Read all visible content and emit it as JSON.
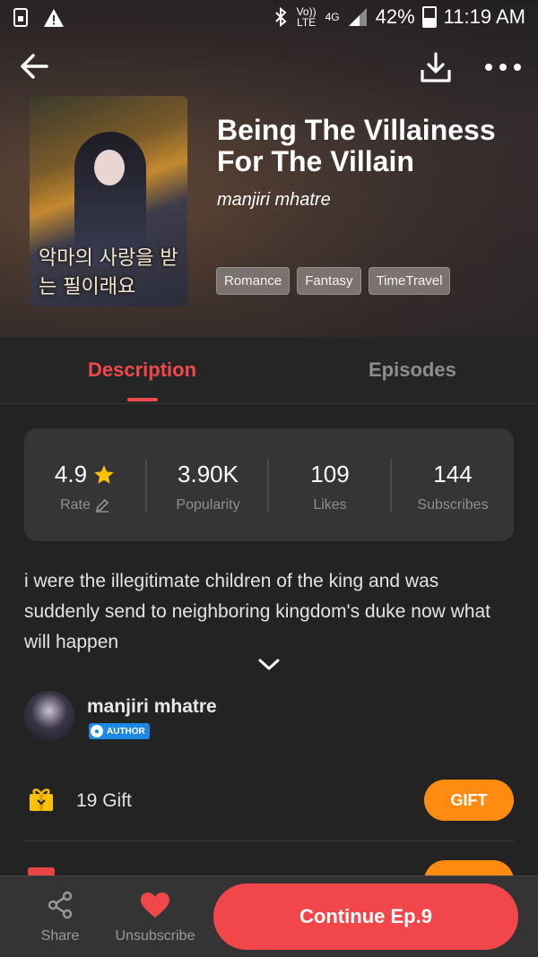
{
  "status": {
    "network_label": "Vo)) LTE",
    "net_type": "4G",
    "battery": "42%",
    "time": "11:19 AM",
    "battery_level": 0.42
  },
  "comic": {
    "title": "Being The Villainess For The Villain",
    "author": "manjiri mhatre",
    "tags": [
      "Romance",
      "Fantasy",
      "TimeTravel"
    ],
    "cover_text": "악마의 사랑을 받는 필이래요"
  },
  "tabs": [
    {
      "label": "Description",
      "active": true
    },
    {
      "label": "Episodes",
      "active": false
    }
  ],
  "stats": [
    {
      "value": "4.9",
      "label": "Rate"
    },
    {
      "value": "3.90K",
      "label": "Popularity"
    },
    {
      "value": "109",
      "label": "Likes"
    },
    {
      "value": "144",
      "label": "Subscribes"
    }
  ],
  "description": "i were the illegitimate children of the king and was suddenly send to neighboring kingdom's duke now what will happen",
  "author_section": {
    "name": "manjiri mhatre",
    "badge": "AUTHOR"
  },
  "gift": {
    "text": "19  Gift",
    "button": "GIFT"
  },
  "bottom_bar": {
    "share": "Share",
    "unsubscribe": "Unsubscribe",
    "continue": "Continue Ep.9"
  },
  "colors": {
    "accent": "#f0494b",
    "gift": "#ff8c10",
    "star": "#ffc107",
    "badge": "#1e88e5"
  },
  "icons": [
    "back-arrow-icon",
    "download-icon",
    "more-icon",
    "star-icon",
    "pencil-icon",
    "chevron-down-icon",
    "gift-icon",
    "share-icon",
    "heart-icon"
  ]
}
